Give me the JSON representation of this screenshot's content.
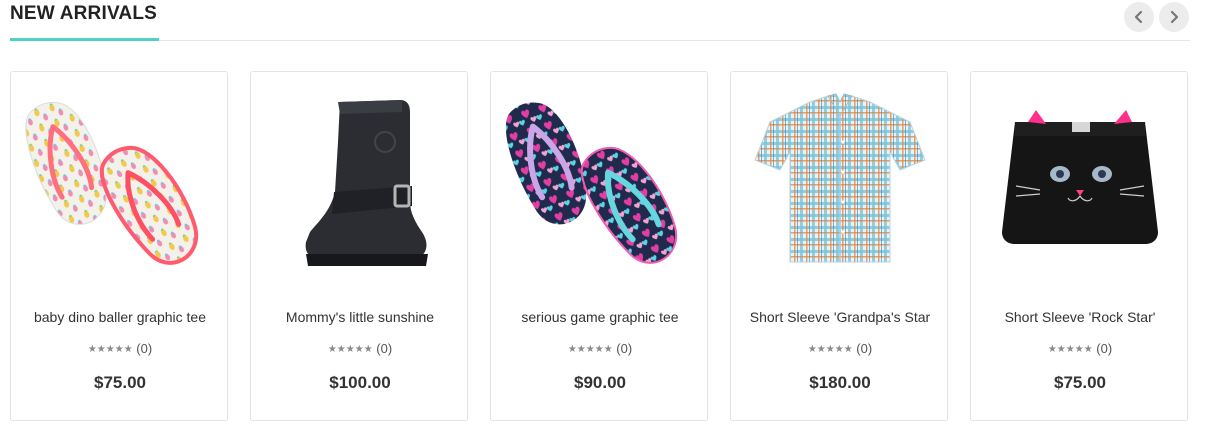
{
  "section": {
    "title": "NEW ARRIVALS",
    "prev_icon": "chevron-left-icon",
    "next_icon": "chevron-right-icon",
    "accent_color": "#4fd1c5"
  },
  "products": [
    {
      "name": "baby dino baller graphic tee",
      "stars": "★★★★★",
      "reviews": "(0)",
      "price": "$75.00",
      "image": "pineapple-flip-flops"
    },
    {
      "name": "Mommy's little sunshine",
      "stars": "★★★★★",
      "reviews": "(0)",
      "price": "$100.00",
      "image": "black-boot"
    },
    {
      "name": "serious game graphic tee",
      "stars": "★★★★★",
      "reviews": "(0)",
      "price": "$90.00",
      "image": "heart-flip-flops"
    },
    {
      "name": "Short Sleeve 'Grandpa's Star",
      "stars": "★★★★★",
      "reviews": "(0)",
      "price": "$180.00",
      "image": "plaid-shirt"
    },
    {
      "name": "Short Sleeve 'Rock Star'",
      "stars": "★★★★★",
      "reviews": "(0)",
      "price": "$75.00",
      "image": "cat-skirt"
    }
  ]
}
